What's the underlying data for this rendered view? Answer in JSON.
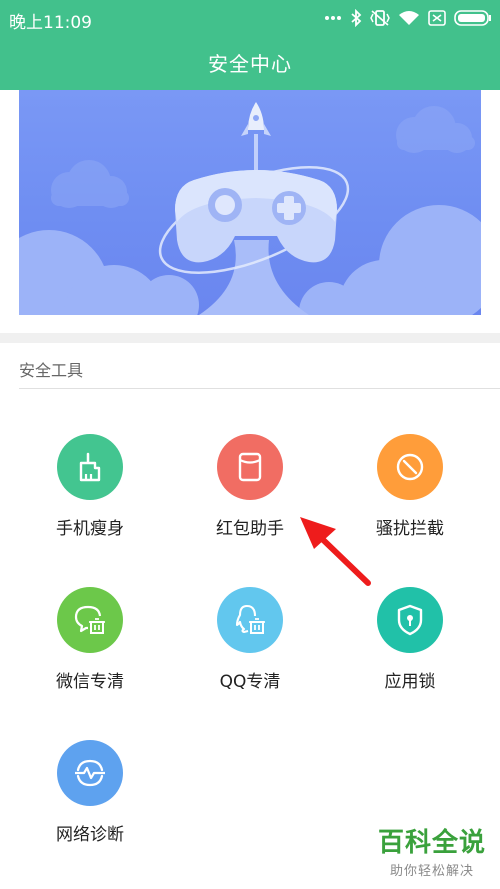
{
  "status_bar": {
    "time": "晚上11:09",
    "icons": [
      "more-dots-icon",
      "bluetooth-icon",
      "vibrate-icon",
      "wifi-icon",
      "sim-icon",
      "battery-icon"
    ]
  },
  "header": {
    "title": "安全中心"
  },
  "section": {
    "title": "安全工具"
  },
  "tools": [
    {
      "label": "手机瘦身",
      "icon": "broom-icon",
      "color": "#43c590"
    },
    {
      "label": "红包助手",
      "icon": "red-packet-icon",
      "color": "#f16d63"
    },
    {
      "label": "骚扰拦截",
      "icon": "block-icon",
      "color": "#ff9d3a"
    },
    {
      "label": "微信专清",
      "icon": "wechat-clean-icon",
      "color": "#6cc84a"
    },
    {
      "label": "QQ专清",
      "icon": "qq-clean-icon",
      "color": "#62c7ee"
    },
    {
      "label": "应用锁",
      "icon": "shield-lock-icon",
      "color": "#21c1a8"
    },
    {
      "label": "网络诊断",
      "icon": "network-icon",
      "color": "#5ea2ef"
    }
  ],
  "watermark": {
    "title": "百科全说",
    "subtitle": "助你轻松解决"
  },
  "colors": {
    "header": "#42c18c",
    "banner": "#7290f3"
  }
}
